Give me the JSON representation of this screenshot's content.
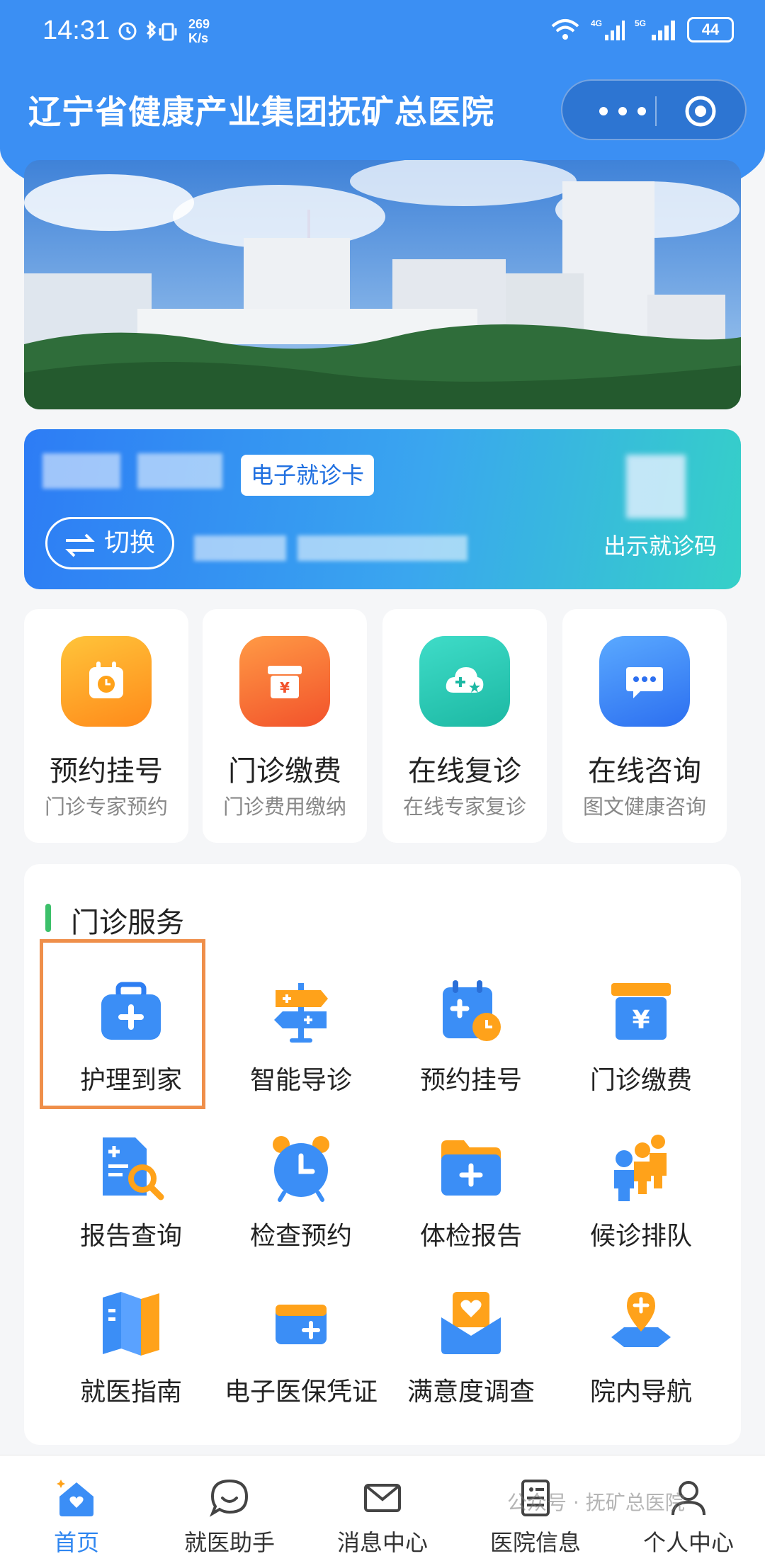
{
  "status_bar": {
    "time": "14:31",
    "net_speed_value": "269",
    "net_speed_unit": "K/s",
    "sig1": "4G",
    "sig2": "5G",
    "battery": "44"
  },
  "app": {
    "title": "辽宁省健康产业集团抚矿总医院"
  },
  "card": {
    "tag": "电子就诊卡",
    "switch_label": "切换",
    "show_code": "出示就诊码"
  },
  "quick": [
    {
      "title": "预约挂号",
      "sub": "门诊专家预约",
      "icon": "calendar-clock-icon",
      "color": "#ffa21a"
    },
    {
      "title": "门诊缴费",
      "sub": "门诊费用缴纳",
      "icon": "yuan-box-icon",
      "color": "#fb6a2c"
    },
    {
      "title": "在线复诊",
      "sub": "在线专家复诊",
      "icon": "cloud-plus-icon",
      "color": "#27c9b4"
    },
    {
      "title": "在线咨询",
      "sub": "图文健康咨询",
      "icon": "chat-bubble-icon",
      "color": "#3b8ef6"
    }
  ],
  "services": {
    "title": "门诊服务",
    "items": [
      {
        "label": "护理到家",
        "icon": "medical-kit-icon"
      },
      {
        "label": "智能导诊",
        "icon": "signpost-icon"
      },
      {
        "label": "预约挂号",
        "icon": "calendar-plus-icon"
      },
      {
        "label": "门诊缴费",
        "icon": "yuan-box-icon"
      },
      {
        "label": "报告查询",
        "icon": "report-search-icon"
      },
      {
        "label": "检查预约",
        "icon": "alarm-clock-icon"
      },
      {
        "label": "体检报告",
        "icon": "folder-plus-icon"
      },
      {
        "label": "候诊排队",
        "icon": "queue-people-icon"
      },
      {
        "label": "就医指南",
        "icon": "map-guide-icon"
      },
      {
        "label": "电子医保凭证",
        "icon": "insurance-card-icon"
      },
      {
        "label": "满意度调查",
        "icon": "heart-envelope-icon"
      },
      {
        "label": "院内导航",
        "icon": "location-pin-icon"
      }
    ]
  },
  "tabs": [
    {
      "label": "首页",
      "icon": "home-icon",
      "active": true
    },
    {
      "label": "就医助手",
      "icon": "chat-smile-icon"
    },
    {
      "label": "消息中心",
      "icon": "mail-icon"
    },
    {
      "label": "医院信息",
      "icon": "document-icon"
    },
    {
      "label": "个人中心",
      "icon": "user-icon"
    }
  ],
  "watermark": "公众号 · 抚矿总医院",
  "colors": {
    "primary": "#3b8ff3",
    "accent_green": "#3cc06a",
    "highlight": "#ef8f4a"
  }
}
